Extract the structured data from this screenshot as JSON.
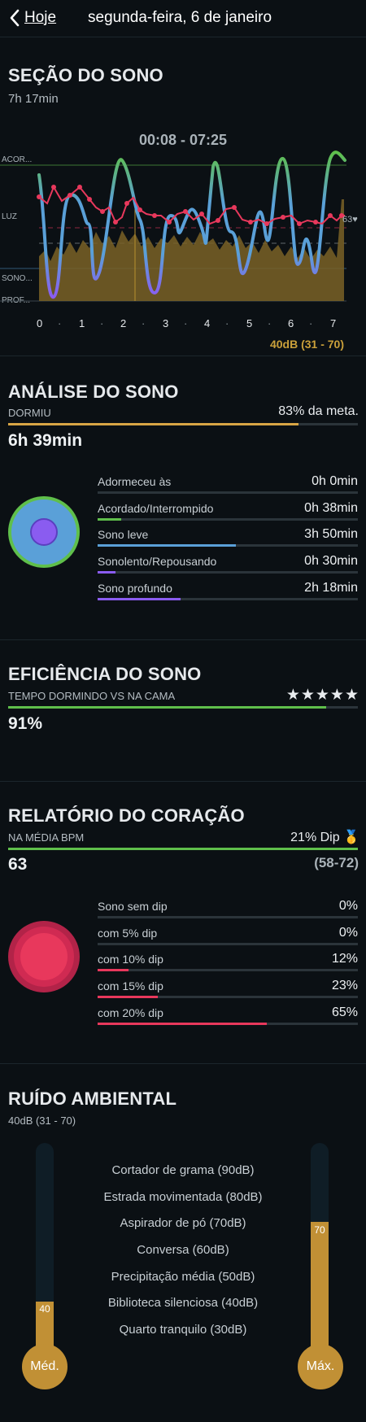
{
  "header": {
    "back_label": "Hoje",
    "date_title": "segunda-feira, 6 de janeiro"
  },
  "session": {
    "title": "SEÇÃO DO SONO",
    "duration": "7h 17min",
    "time_range": "00:08 - 07:25",
    "y_labels": [
      "ACOR...",
      "LUZ",
      "SONO...",
      "PROF..."
    ],
    "hr_marker": "63♥",
    "x_ticks": [
      "0",
      "1",
      "2",
      "3",
      "4",
      "5",
      "6",
      "7"
    ],
    "x_dot": "·",
    "noise_summary": "40dB (31 - 70)",
    "colors": {
      "awake": "#5fbf4b",
      "light": "#5aa0d8",
      "deep": "#8a5cf0",
      "hr": "#e8385c",
      "noise": "#b8912f"
    }
  },
  "analysis": {
    "title": "ANÁLISE DO SONO",
    "slept_label": "DORMIU",
    "goal_text": "83% da meta.",
    "goal_fraction": 0.83,
    "slept_value": "6h 39min",
    "stats": [
      {
        "label": "Adormeceu às",
        "value": "0h 0min",
        "fraction": 0,
        "color": "#5fbf4b"
      },
      {
        "label": "Acordado/Interrompido",
        "value": "0h 38min",
        "fraction": 0.09,
        "color": "#5fbf4b"
      },
      {
        "label": "Sono leve",
        "value": "3h 50min",
        "fraction": 0.53,
        "color": "#5aa0d8"
      },
      {
        "label": "Sonolento/Repousando",
        "value": "0h 30min",
        "fraction": 0.07,
        "color": "#8a5cf0"
      },
      {
        "label": "Sono profundo",
        "value": "2h 18min",
        "fraction": 0.32,
        "color": "#8a5cf0"
      }
    ]
  },
  "efficiency": {
    "title": "EFICIÊNCIA DO SONO",
    "subtitle": "TEMPO DORMINDO VS NA CAMA",
    "stars": "★★★★★",
    "value": "91%",
    "fraction": 0.91
  },
  "heart": {
    "title": "RELATÓRIO DO CORAÇÃO",
    "subtitle": "NA MÉDIA BPM",
    "dip_text": "21% Dip",
    "medal": "🥇",
    "bpm": "63",
    "range": "(58-72)",
    "dips": [
      {
        "label": "Sono sem dip",
        "value": "0%",
        "fraction": 0
      },
      {
        "label": "com 5% dip",
        "value": "0%",
        "fraction": 0
      },
      {
        "label": "com 10% dip",
        "value": "12%",
        "fraction": 0.12
      },
      {
        "label": "com 15% dip",
        "value": "23%",
        "fraction": 0.23
      },
      {
        "label": "com 20% dip",
        "value": "65%",
        "fraction": 0.65
      }
    ]
  },
  "noise": {
    "title": "RUÍDO AMBIENTAL",
    "subtitle": "40dB (31 - 70)",
    "references": [
      "Cortador de grama (90dB)",
      "Estrada movimentada (80dB)",
      "Aspirador de pó (70dB)",
      "Conversa (60dB)",
      "Precipitação média (50dB)",
      "Biblioteca silenciosa (40dB)",
      "Quarto tranquilo (30dB)"
    ],
    "avg_value": "40",
    "avg_label": "Méd.",
    "max_value": "70",
    "max_label": "Máx."
  }
}
